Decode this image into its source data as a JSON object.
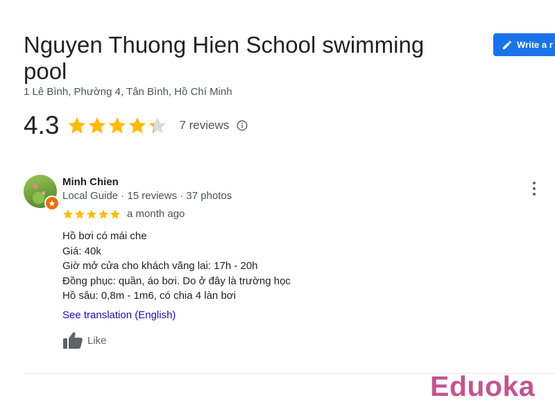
{
  "place": {
    "title": "Nguyen Thuong Hien School swimming pool",
    "address": "1 Lê Bình, Phường 4, Tân Bình, Hồ Chí Minh"
  },
  "actions": {
    "write_review_label": "Write a r"
  },
  "rating": {
    "value": "4.3",
    "stars": 4.3,
    "review_count_label": "7 reviews"
  },
  "review": {
    "author": "Minh Chien",
    "author_meta": "Local Guide · 15 reviews · 37 photos",
    "stars": 5,
    "time": "a month ago",
    "lines": [
      "Hồ bơi có mái che",
      "Giá: 40k",
      "Giờ mở cửa cho khách vãng lai: 17h - 20h",
      "Đồng phục: quần, áo bơi. Do ở đây là trường học",
      "Hồ sâu: 0,8m - 1m6, có chia 4 làn bơi"
    ],
    "translation_link": "See translation (English)",
    "like_label": "Like"
  },
  "watermark": {
    "text": "Eduoka"
  },
  "colors": {
    "star": "#fbbc04",
    "star_empty": "#dadce0",
    "accent": "#1a73e8",
    "link": "#1a0dab",
    "guide_badge": "#e8710a",
    "watermark": "#c2558f"
  }
}
